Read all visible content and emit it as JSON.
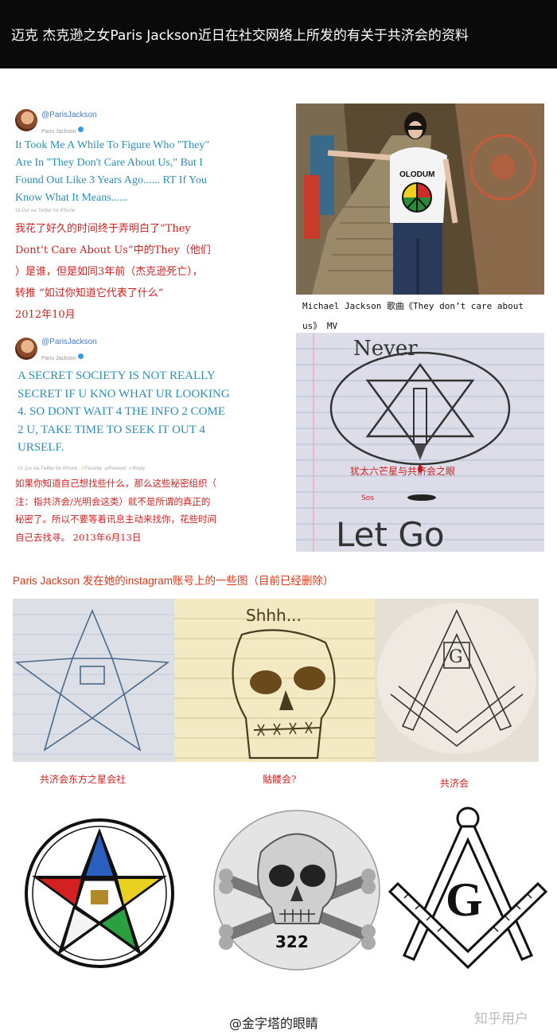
{
  "header": {
    "title": "迈克 杰克逊之女Paris Jackson近日在社交网络上所发的有关于共济会的资料"
  },
  "tweet1": {
    "handle": "@ParisJackson",
    "name": "Paris Jackson",
    "lines": [
      "It Took Me A While To Figure Who \"They\"",
      "Are In \"They Don't Care About Us,\" But I",
      "Found Out Like 3 Years Ago...... RT If You",
      "Know What It Means......"
    ],
    "meta": "19 Oct via Twitter for iPhone",
    "translation": [
      "我花了好久的时间终于弄明白了“They",
      "Dont’t Care About Us”中的They（他们",
      "）是谁，但是如同3年前（杰克逊死亡），",
      "转推 “如过你知道它代表了什么”",
      "2012年10月"
    ]
  },
  "tweet2": {
    "handle": "@ParisJackson",
    "name": "Paris Jackson",
    "lines": [
      "A SECRET SOCIETY IS NOT REALLY",
      "SECRET IF U KNO WHAT UR LOOKING",
      "4. SO DONT WAIT 4 THE INFO 2 COME",
      "2 U, TAKE TIME TO SEEK IT OUT 4",
      "URSELF."
    ],
    "meta": "13 Jun via Twitter for iPhone",
    "actions": [
      "Favorite",
      "Retweet",
      "Reply"
    ],
    "translation": [
      "如果你知道自己想找些什么，那么这些秘密组织（",
      "注：指共济会/光明会这类）就不是所谓的真正的",
      "秘密了。所以不要等着讯息主动来找你，花些时间",
      "自己去找寻。 2013年6月13日"
    ]
  },
  "photo1": {
    "shirt_text": "OLODUM",
    "caption": "Michael Jackson 歌曲《They don’t care about us》 MV"
  },
  "photo2": {
    "top_text": "Never",
    "bottom_text": "Let Go",
    "overlay_red": "犹太六芒星与共济会之眼",
    "overlay_small": "Sos"
  },
  "section_title": "Paris Jackson 发在她的instagram账号上的一些图（目前已经删除）",
  "insta2_text": "Shhh...",
  "labels": [
    "共济会东方之星会社",
    "骷髅会?",
    "共济会"
  ],
  "skull_number": "322",
  "mason_letter": "G",
  "watermark": "@金字塔的眼睛",
  "zhihu": "知乎用户",
  "colors": {
    "header_bg": "#0a0a0a",
    "tweet_blue": "#2a8fb8",
    "translation_red": "#d42020",
    "section_title_orange": "#d93a1c"
  }
}
